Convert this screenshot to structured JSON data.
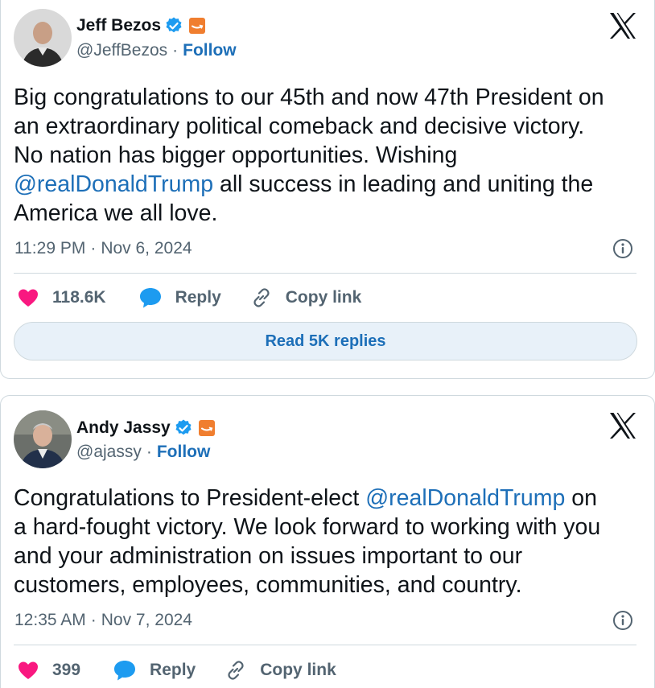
{
  "tweets": [
    {
      "author": {
        "name": "Jeff Bezos",
        "handle": "@JeffBezos",
        "follow_label": "Follow",
        "verified_icon": "verified-badge-icon",
        "affiliate_icon": "amazon-affiliate-icon"
      },
      "text": {
        "line1": "Big congratulations to our 45th and now 47th President on",
        "line2": "an extraordinary political comeback and decisive victory.",
        "line3": "No nation has bigger opportunities. Wishing",
        "mention": "@realDonaldTrump",
        "line4_rest": " all success in leading and uniting the",
        "line5": "America we all love."
      },
      "time": "11:29 PM",
      "separator": "·",
      "date": "Nov 6, 2024",
      "likes": "118.6K",
      "reply_label": "Reply",
      "copy_label": "Copy link",
      "read_replies": "Read 5K replies"
    },
    {
      "author": {
        "name": "Andy Jassy",
        "handle": "@ajassy",
        "follow_label": "Follow",
        "verified_icon": "verified-badge-icon",
        "affiliate_icon": "amazon-affiliate-icon"
      },
      "text": {
        "line1_pre": "Congratulations to President-elect ",
        "mention": "@realDonaldTrump",
        "line1_post": " on",
        "line2": "a hard-fought victory. We look forward to working with you",
        "line3": "and your administration on issues important to our",
        "line4": "customers, employees, communities, and country."
      },
      "time": "12:35 AM",
      "separator": "·",
      "date": "Nov 7, 2024",
      "likes": "399",
      "reply_label": "Reply",
      "copy_label": "Copy link"
    }
  ],
  "colors": {
    "link": "#1d6fb8",
    "like": "#f91880",
    "secondary_text": "#536471",
    "verified": "#1d9bf0",
    "affiliate": "#f07e2f"
  }
}
